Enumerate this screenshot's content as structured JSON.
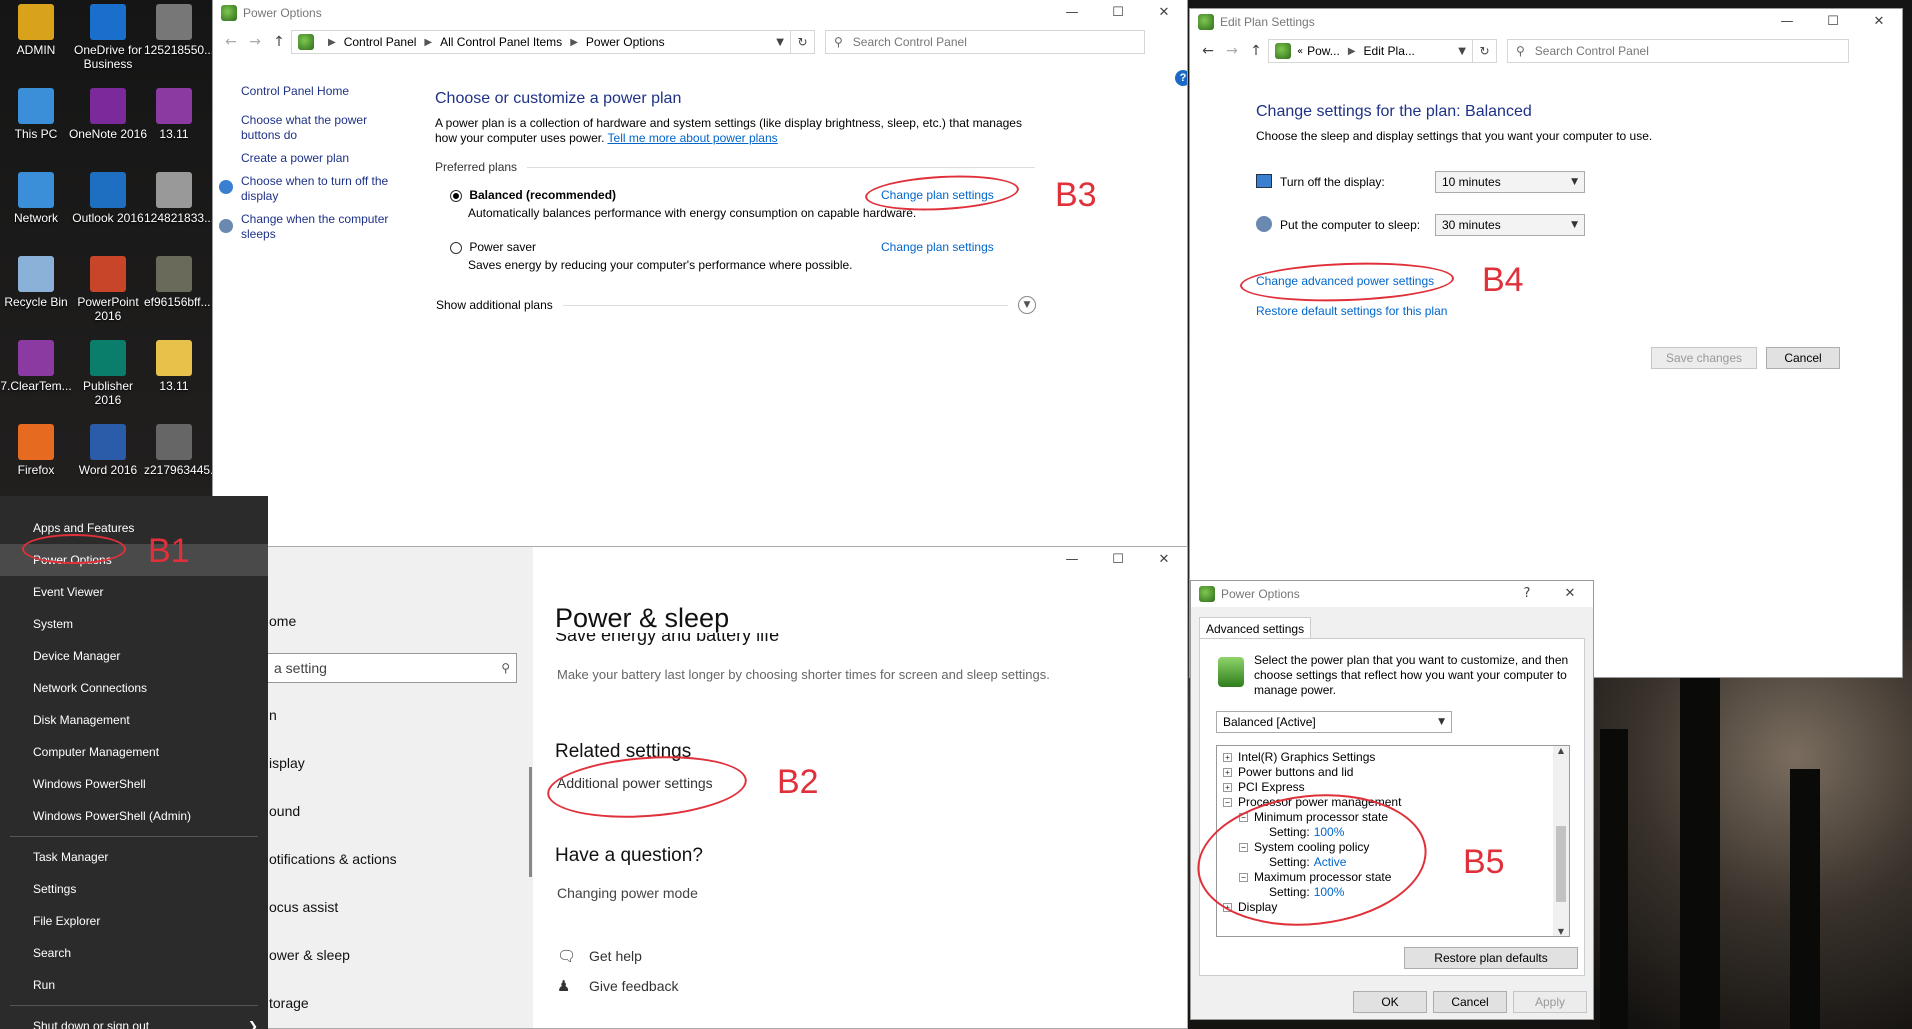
{
  "desktop": {
    "icons": [
      {
        "label": "ADMIN",
        "icon": "user-folder-icon",
        "color": "#d9a21b"
      },
      {
        "label": "This PC",
        "icon": "computer-icon",
        "color": "#3a8fd8"
      },
      {
        "label": "Network",
        "icon": "network-icon",
        "color": "#3a8fd8"
      },
      {
        "label": "Recycle Bin",
        "icon": "recycle-bin-icon",
        "color": "#8ab2d9"
      },
      {
        "label": "7.ClearTem...",
        "icon": "archive-icon",
        "color": "#8a3aa0"
      },
      {
        "label": "Firefox",
        "icon": "firefox-icon",
        "color": "#e66a1f"
      },
      {
        "label": "OneDrive for Business",
        "icon": "onedrive-icon",
        "color": "#1a6fcc"
      },
      {
        "label": "OneNote 2016",
        "icon": "onenote-icon",
        "color": "#7b2a9b"
      },
      {
        "label": "Outlook 2016",
        "icon": "outlook-icon",
        "color": "#1e6fc1"
      },
      {
        "label": "PowerPoint 2016",
        "icon": "powerpoint-icon",
        "color": "#c8452a"
      },
      {
        "label": "Publisher 2016",
        "icon": "publisher-icon",
        "color": "#0b7d6b"
      },
      {
        "label": "Word 2016",
        "icon": "word-icon",
        "color": "#2b5caa"
      },
      {
        "label": "125218550...",
        "icon": "image-thumbnail-icon",
        "color": "#777777"
      },
      {
        "label": "13.11",
        "icon": "archive-icon",
        "color": "#8a3aa0"
      },
      {
        "label": "124821833...",
        "icon": "image-thumbnail-icon",
        "color": "#999999"
      },
      {
        "label": "ef96156bff...",
        "icon": "image-thumbnail-icon",
        "color": "#6a6a5a"
      },
      {
        "label": "13.11",
        "icon": "folder-icon",
        "color": "#e8c14a"
      },
      {
        "label": "z217963445...",
        "icon": "image-thumbnail-icon",
        "color": "#666666"
      }
    ]
  },
  "power_options": {
    "title": "Power Options",
    "breadcrumb": [
      "Control Panel",
      "All Control Panel Items",
      "Power Options"
    ],
    "search_placeholder": "Search Control Panel",
    "sidebar": [
      "Control Panel Home",
      "Choose what the power buttons do",
      "Create a power plan",
      "Choose when to turn off the display",
      "Change when the computer sleeps"
    ],
    "heading": "Choose or customize a power plan",
    "description": "A power plan is a collection of hardware and system settings (like display brightness, sleep, etc.) that manages how your computer uses power.",
    "tell_more": "Tell me more about power plans",
    "preferred_plans": "Preferred plans",
    "plans": [
      {
        "name": "Balanced (recommended)",
        "desc": "Automatically balances performance with energy consumption on capable hardware.",
        "link": "Change plan settings",
        "selected": true
      },
      {
        "name": "Power saver",
        "desc": "Saves energy by reducing your computer's performance where possible.",
        "link": "Change plan settings",
        "selected": false
      }
    ],
    "show_additional": "Show additional plans",
    "help": "?"
  },
  "edit_plan": {
    "title": "Edit Plan Settings",
    "breadcrumb": [
      "Pow...",
      "Edit Pla..."
    ],
    "search_placeholder": "Search Control Panel",
    "heading": "Change settings for the plan: Balanced",
    "subtitle": "Choose the sleep and display settings that you want your computer to use.",
    "display_label": "Turn off the display:",
    "display_value": "10 minutes",
    "sleep_label": "Put the computer to sleep:",
    "sleep_value": "30 minutes",
    "advanced_link": "Change advanced power settings",
    "restore_link": "Restore default settings for this plan",
    "save": "Save changes",
    "cancel": "Cancel"
  },
  "winx": {
    "group1": [
      "Apps and Features",
      "Power Options",
      "Event Viewer",
      "System",
      "Device Manager",
      "Network Connections",
      "Disk Management",
      "Computer Management",
      "Windows PowerShell",
      "Windows PowerShell (Admin)"
    ],
    "group2": [
      "Task Manager",
      "Settings",
      "File Explorer",
      "Search",
      "Run"
    ],
    "group3": [
      "Shut down or sign out"
    ],
    "selected": "Power Options"
  },
  "settings": {
    "nav_home": "ome",
    "search_placeholder": "a setting",
    "nav": [
      "n",
      "isplay",
      "ound",
      "otifications & actions",
      "ocus assist",
      "ower & sleep",
      "torage"
    ],
    "title": "Power & sleep",
    "section_partial": "Save energy and battery life",
    "section_desc": "Make your battery last longer by choosing shorter times for screen and sleep settings.",
    "related_heading": "Related settings",
    "additional_link": "Additional power settings",
    "question_heading": "Have a question?",
    "question_link": "Changing power mode",
    "get_help": "Get help",
    "give_feedback": "Give feedback"
  },
  "advanced": {
    "title": "Power Options",
    "help": "?",
    "tab": "Advanced settings",
    "intro": "Select the power plan that you want to customize, and then choose settings that reflect how you want your computer to manage power.",
    "plan": "Balanced [Active]",
    "tree": [
      {
        "label": "Intel(R) Graphics Settings",
        "level": 0,
        "expander": "+"
      },
      {
        "label": "Power buttons and lid",
        "level": 0,
        "expander": "+"
      },
      {
        "label": "PCI Express",
        "level": 0,
        "expander": "+"
      },
      {
        "label": "Processor power management",
        "level": 0,
        "expander": "-"
      },
      {
        "label": "Minimum processor state",
        "level": 1,
        "expander": "-"
      },
      {
        "label": "Setting:",
        "value": "100%",
        "level": 2
      },
      {
        "label": "System cooling policy",
        "level": 1,
        "expander": "-"
      },
      {
        "label": "Setting:",
        "value": "Active",
        "level": 2
      },
      {
        "label": "Maximum processor state",
        "level": 1,
        "expander": "-"
      },
      {
        "label": "Setting:",
        "value": "100%",
        "level": 2
      },
      {
        "label": "Display",
        "level": 0,
        "expander": "+"
      }
    ],
    "restore": "Restore plan defaults",
    "ok": "OK",
    "cancel": "Cancel",
    "apply": "Apply"
  },
  "annotations": {
    "b1": "B1",
    "b2": "B2",
    "b3": "B3",
    "b4": "B4",
    "b5": "B5",
    "color": "#e0303a"
  }
}
